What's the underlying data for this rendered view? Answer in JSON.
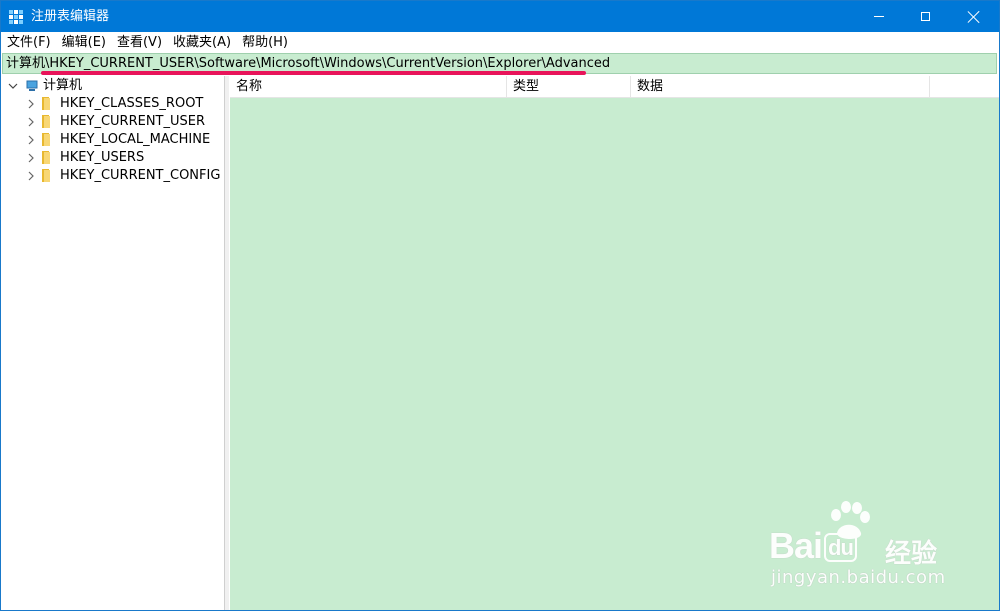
{
  "window": {
    "title": "注册表编辑器",
    "title_bar_color": "#0078d7"
  },
  "menu": {
    "items": [
      {
        "label": "文件(F)"
      },
      {
        "label": "编辑(E)"
      },
      {
        "label": "查看(V)"
      },
      {
        "label": "收藏夹(A)"
      },
      {
        "label": "帮助(H)"
      }
    ]
  },
  "address": {
    "path": "计算机\\HKEY_CURRENT_USER\\Software\\Microsoft\\Windows\\CurrentVersion\\Explorer\\Advanced",
    "background_color": "#c8ecd0",
    "underline_color": "#e8145a"
  },
  "tree": {
    "root": {
      "label": "计算机",
      "icon": "computer-icon",
      "expanded": true
    },
    "children": [
      {
        "label": "HKEY_CLASSES_ROOT",
        "icon": "folder-icon"
      },
      {
        "label": "HKEY_CURRENT_USER",
        "icon": "folder-icon"
      },
      {
        "label": "HKEY_LOCAL_MACHINE",
        "icon": "folder-icon"
      },
      {
        "label": "HKEY_USERS",
        "icon": "folder-icon"
      },
      {
        "label": "HKEY_CURRENT_CONFIG",
        "icon": "folder-icon"
      }
    ]
  },
  "list": {
    "columns": [
      {
        "label": "名称"
      },
      {
        "label": "类型"
      },
      {
        "label": "数据"
      }
    ],
    "background_color": "#c8ecd0"
  },
  "watermark": {
    "brand": "Bai",
    "brand_suffix": "du",
    "jingyan": "经验",
    "url": "jingyan.baidu.com"
  }
}
